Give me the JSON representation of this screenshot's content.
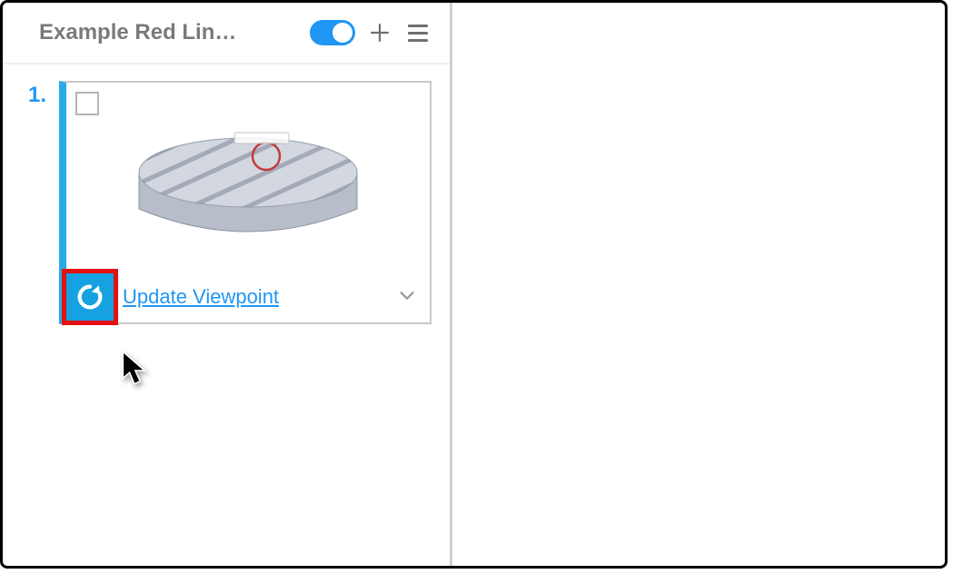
{
  "panel": {
    "title": "Example Red Lin…",
    "toggle_on": true
  },
  "item": {
    "number": "1.",
    "action_label": "Update Viewpoint"
  },
  "icons": {
    "add": "plus-icon",
    "menu": "hamburger-icon",
    "refresh": "refresh-icon",
    "chevron": "chevron-down-icon"
  },
  "colors": {
    "accent": "#2196f3",
    "highlight_outline": "#e41111",
    "refresh_bg": "#16a2e0",
    "card_accent": "#29a9e8"
  }
}
